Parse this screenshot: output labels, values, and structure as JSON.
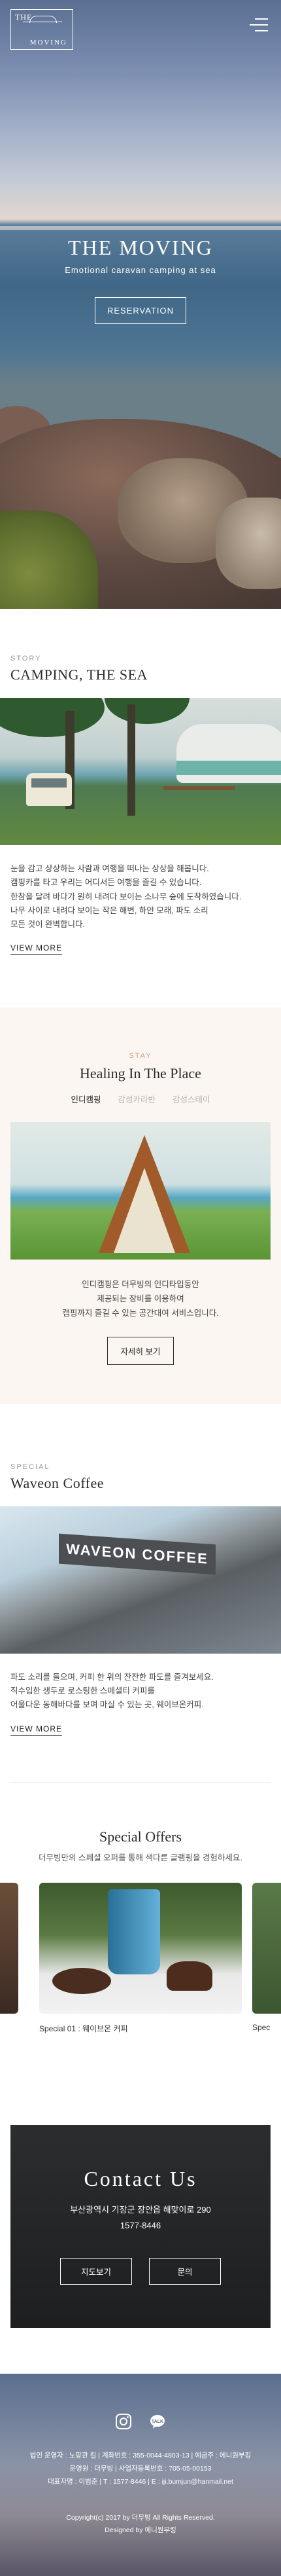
{
  "header": {
    "logo_top": "THE",
    "logo_bottom": "MOVING"
  },
  "hero": {
    "title": "THE MOVING",
    "subtitle": "Emotional caravan camping at sea",
    "button": "RESERVATION"
  },
  "story": {
    "label": "STORY",
    "title": "CAMPING, THE SEA",
    "lines": [
      "눈을 감고 상상하는 사람과 여행을 떠나는 상상을 해봅니다.",
      "캠핑카를 타고 우리는 어디서든 여행을 즐길 수 있습니다.",
      "한참을 달려 바다가 원히 내려다 보이는 소나무 숲에 도착하였습니다.",
      "나무 사이로 내려다 보이는 작은 해변, 하얀 모래, 파도 소리",
      "모든 것이 완벽합니다."
    ],
    "more": "VIEW MORE"
  },
  "stay": {
    "label": "STAY",
    "title": "Healing In The Place",
    "tabs": [
      "인디캠핑",
      "감성카라반",
      "감성스테이"
    ],
    "active_tab": 0,
    "lines": [
      "인디캠핑은 더무빙의 인디타입동안",
      "제공되는 장비를 이용하여",
      "캠핑까지 즐길 수 있는 공간대여 서비스입니다."
    ],
    "button": "자세히 보기"
  },
  "special": {
    "label": "SPECIAL",
    "title": "Waveon Coffee",
    "sign": "WAVEON COFFEE",
    "lines": [
      "파도 소리를 들으며, 커피 한 위의 잔잔한 파도를 즐겨보세요.",
      "직수입한 생두로 로스팅한 스페셜티 커피를",
      "어울다운 동해바다를 보며 마실 수 있는 곳, 웨이브온커피."
    ],
    "more": "VIEW MORE"
  },
  "offers": {
    "title": "Special Offers",
    "subtitle": "더무빙만의 스페셜 오퍼를 통해 색다른 글램핑을 경험하세요.",
    "slides": [
      {
        "caption": ""
      },
      {
        "caption": "Special 01 : 웨이브온 커피"
      },
      {
        "caption": "Spec"
      }
    ]
  },
  "contact": {
    "title": "Contact Us",
    "address": "부산광역시 기장군 장안읍 해맞이로 290",
    "phone": "1577-8446",
    "buttons": [
      "지도보기",
      "문의"
    ]
  },
  "footer": {
    "sns": [
      "instagram-icon",
      "kakaotalk-icon"
    ],
    "info": [
      "법인 운영자 : 노팡관 킬  |  계좌번호 : 355-0044-4803-13  |  예금주 : 에니원부킹",
      "운영원 : 더무빙  |  사업자등록번호 : 705-05-00153",
      "대표자명 : 이범준  |  T : 1577-8446  |  E : iji.bumjun@hanmail.net"
    ],
    "copyright": "Copyright(c) 2017 by 더무빙 All Rights Reserved.",
    "designed": "Designed by 에니원부킹"
  },
  "colors": {
    "accent": "#d9a079",
    "stay_bg": "#fbf6f1",
    "text": "#333333"
  }
}
